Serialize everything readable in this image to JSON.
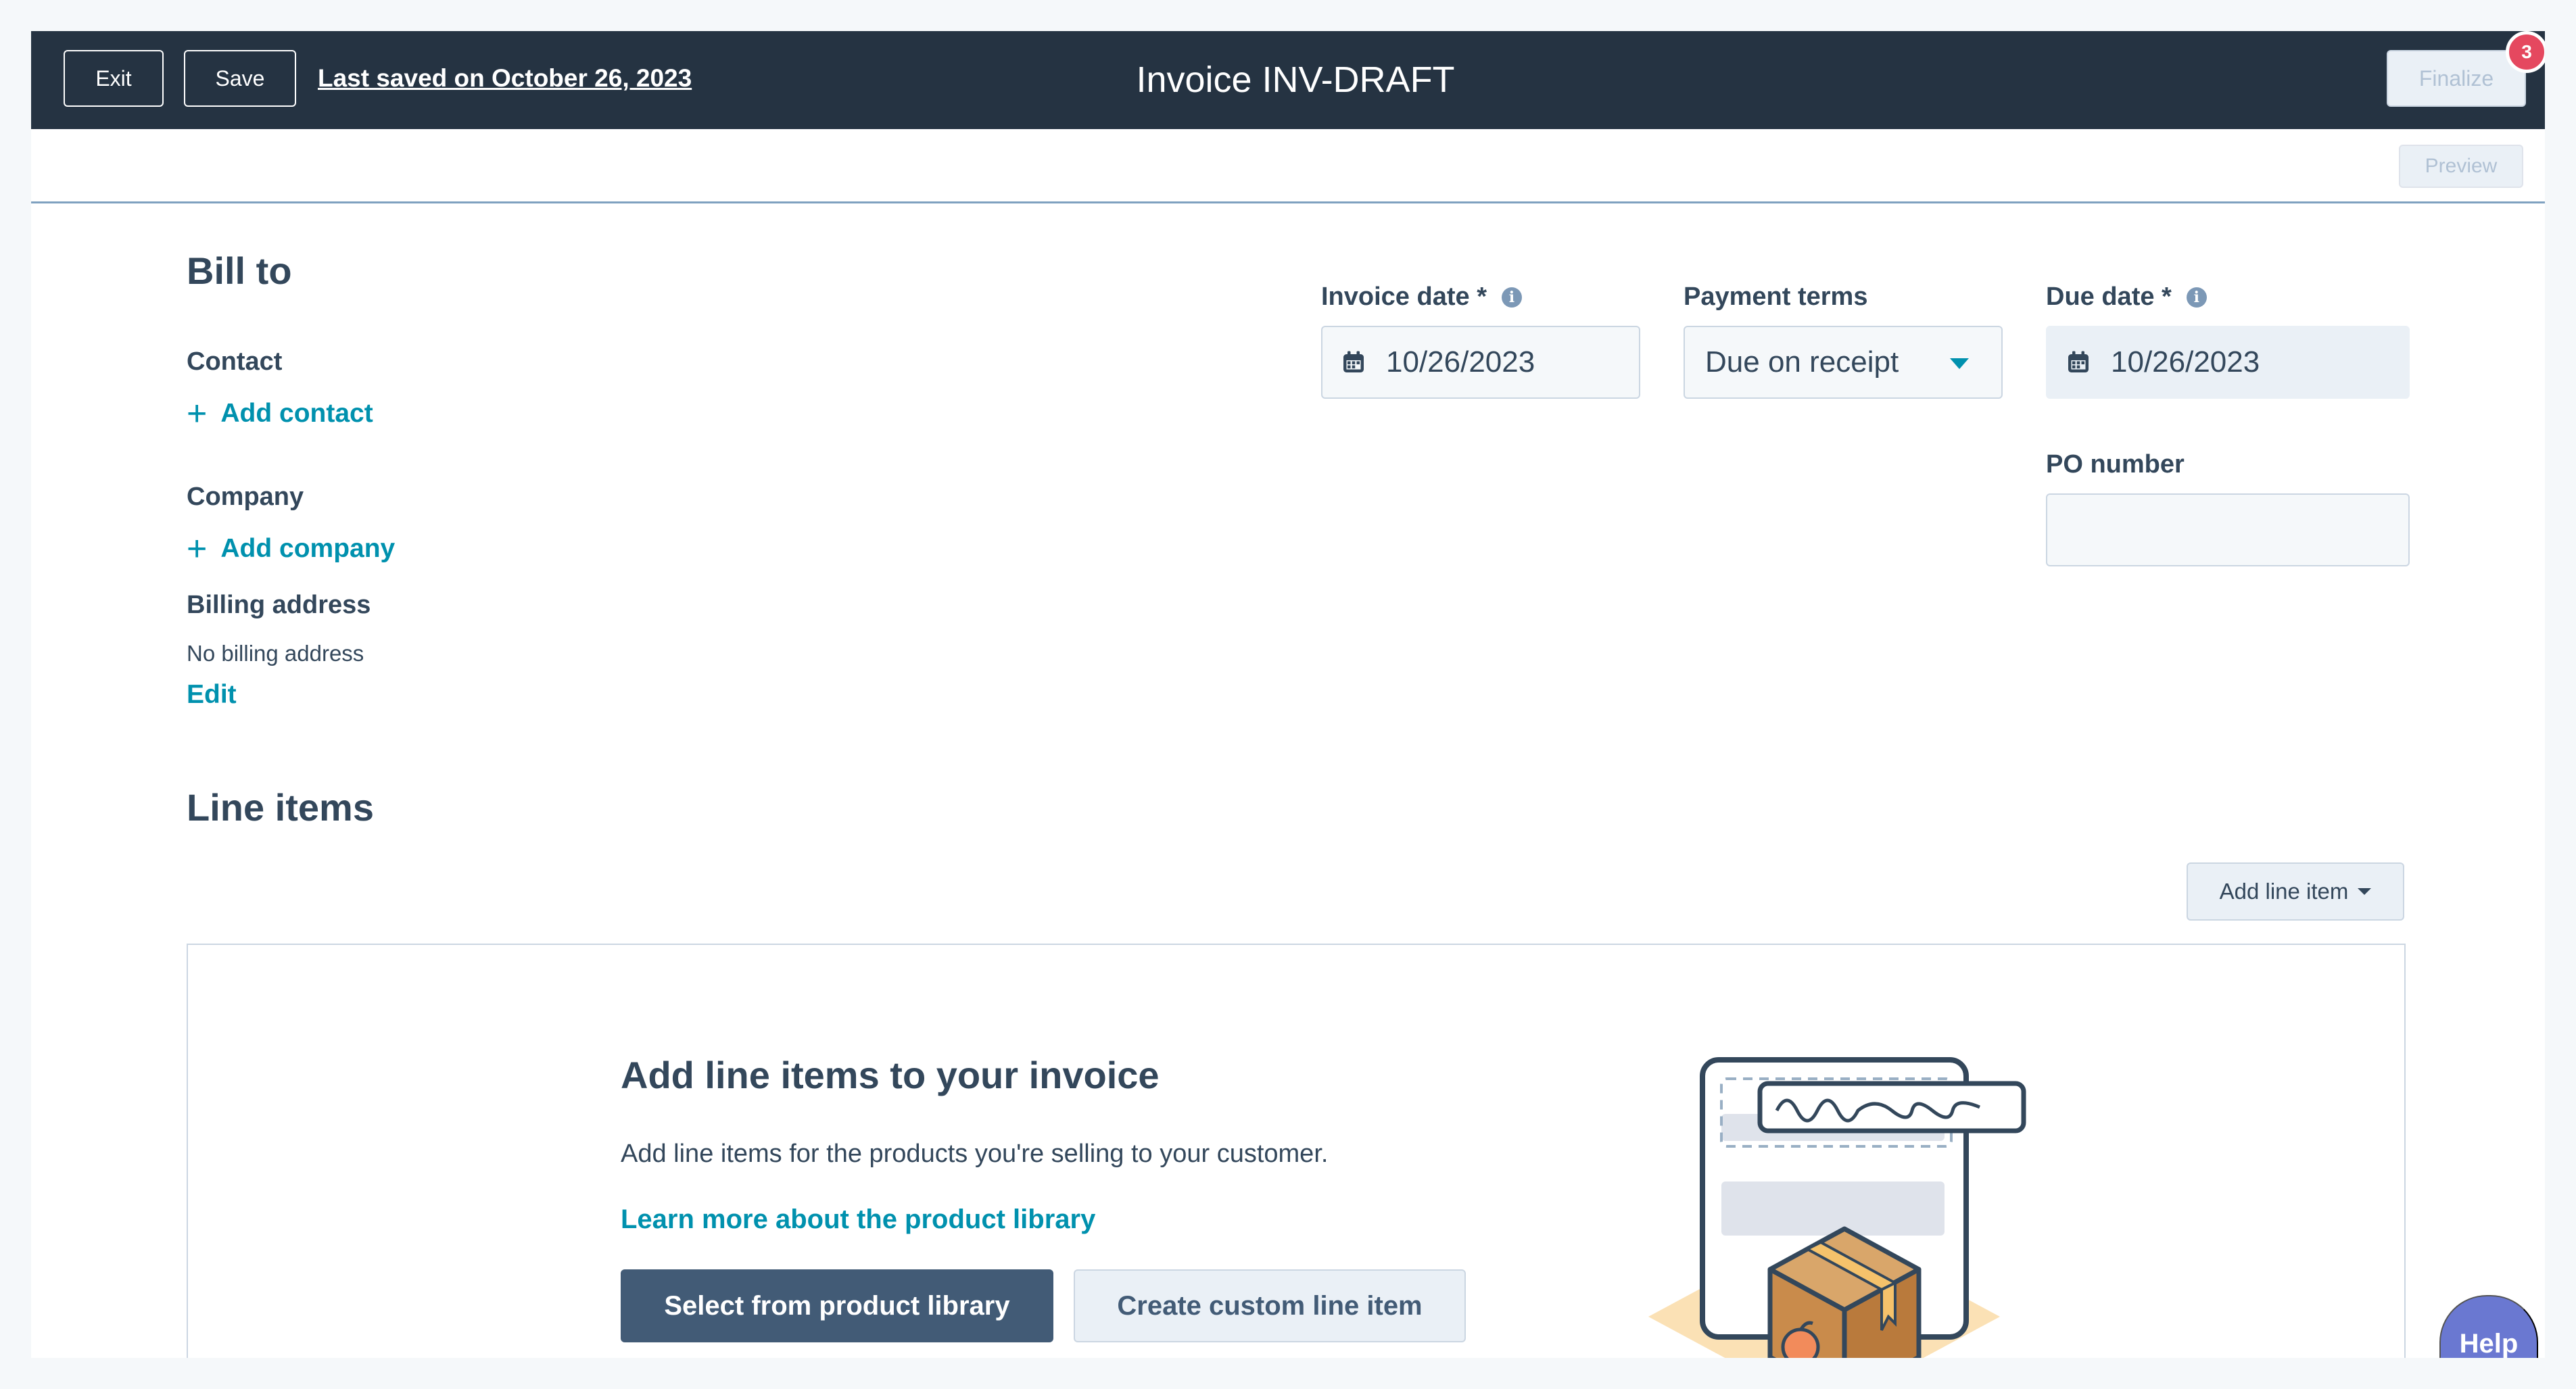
{
  "header": {
    "exit_label": "Exit",
    "save_label": "Save",
    "last_saved": "Last saved on October 26, 2023",
    "title": "Invoice INV-DRAFT",
    "finalize_label": "Finalize",
    "notification_count": "3"
  },
  "subbar": {
    "preview_label": "Preview"
  },
  "bill_to": {
    "heading": "Bill to",
    "contact_label": "Contact",
    "add_contact": "Add contact",
    "company_label": "Company",
    "add_company": "Add company",
    "billing_label": "Billing address",
    "billing_value": "No billing address",
    "edit_label": "Edit"
  },
  "invoice_fields": {
    "invoice_date_label": "Invoice date *",
    "invoice_date_value": "10/26/2023",
    "payment_terms_label": "Payment terms",
    "payment_terms_value": "Due on receipt",
    "due_date_label": "Due date *",
    "due_date_value": "10/26/2023",
    "po_label": "PO number",
    "po_value": ""
  },
  "line_items": {
    "heading": "Line items",
    "add_button": "Add line item",
    "empty_title": "Add line items to your invoice",
    "empty_description": "Add line items for the products you're selling to your customer.",
    "learn_more": "Learn more about the product library",
    "select_button": "Select from product library",
    "create_button": "Create custom line item"
  },
  "help": {
    "label": "Help"
  },
  "icons": {
    "plus": "plus-icon",
    "calendar": "calendar-icon",
    "info": "info-icon",
    "dropdown": "caret-down-icon"
  },
  "colors": {
    "header_bg": "#253342",
    "link": "#0091ae",
    "primary_button": "#425b76",
    "badge": "#e5485f",
    "help": "#6a78d1"
  }
}
